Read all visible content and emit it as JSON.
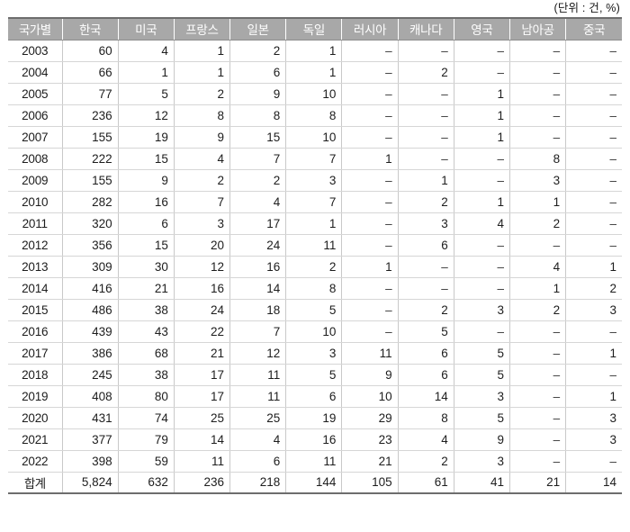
{
  "unit_note": "(단위 : 건, %)",
  "table": {
    "columns": [
      "국가별",
      "한국",
      "미국",
      "프랑스",
      "일본",
      "독일",
      "러시아",
      "캐나다",
      "영국",
      "남아공",
      "중국"
    ],
    "rows": [
      {
        "year": "2003",
        "values": [
          "60",
          "4",
          "1",
          "2",
          "1",
          "–",
          "–",
          "–",
          "–",
          "–"
        ]
      },
      {
        "year": "2004",
        "values": [
          "66",
          "1",
          "1",
          "6",
          "1",
          "–",
          "2",
          "–",
          "–",
          "–"
        ]
      },
      {
        "year": "2005",
        "values": [
          "77",
          "5",
          "2",
          "9",
          "10",
          "–",
          "–",
          "1",
          "–",
          "–"
        ]
      },
      {
        "year": "2006",
        "values": [
          "236",
          "12",
          "8",
          "8",
          "8",
          "–",
          "–",
          "1",
          "–",
          "–"
        ]
      },
      {
        "year": "2007",
        "values": [
          "155",
          "19",
          "9",
          "15",
          "10",
          "–",
          "–",
          "1",
          "–",
          "–"
        ]
      },
      {
        "year": "2008",
        "values": [
          "222",
          "15",
          "4",
          "7",
          "7",
          "1",
          "–",
          "–",
          "8",
          "–"
        ]
      },
      {
        "year": "2009",
        "values": [
          "155",
          "9",
          "2",
          "2",
          "3",
          "–",
          "1",
          "–",
          "3",
          "–"
        ]
      },
      {
        "year": "2010",
        "values": [
          "282",
          "16",
          "7",
          "4",
          "7",
          "–",
          "2",
          "1",
          "1",
          "–"
        ]
      },
      {
        "year": "2011",
        "values": [
          "320",
          "6",
          "3",
          "17",
          "1",
          "–",
          "3",
          "4",
          "2",
          "–"
        ]
      },
      {
        "year": "2012",
        "values": [
          "356",
          "15",
          "20",
          "24",
          "11",
          "–",
          "6",
          "–",
          "–",
          "–"
        ]
      },
      {
        "year": "2013",
        "values": [
          "309",
          "30",
          "12",
          "16",
          "2",
          "1",
          "–",
          "–",
          "4",
          "1"
        ]
      },
      {
        "year": "2014",
        "values": [
          "416",
          "21",
          "16",
          "14",
          "8",
          "–",
          "–",
          "–",
          "1",
          "2"
        ]
      },
      {
        "year": "2015",
        "values": [
          "486",
          "38",
          "24",
          "18",
          "5",
          "–",
          "2",
          "3",
          "2",
          "3"
        ]
      },
      {
        "year": "2016",
        "values": [
          "439",
          "43",
          "22",
          "7",
          "10",
          "–",
          "5",
          "–",
          "–",
          "–"
        ]
      },
      {
        "year": "2017",
        "values": [
          "386",
          "68",
          "21",
          "12",
          "3",
          "11",
          "6",
          "5",
          "–",
          "1"
        ]
      },
      {
        "year": "2018",
        "values": [
          "245",
          "38",
          "17",
          "11",
          "5",
          "9",
          "6",
          "5",
          "–",
          "–"
        ]
      },
      {
        "year": "2019",
        "values": [
          "408",
          "80",
          "17",
          "11",
          "6",
          "10",
          "14",
          "3",
          "–",
          "1"
        ]
      },
      {
        "year": "2020",
        "values": [
          "431",
          "74",
          "25",
          "25",
          "19",
          "29",
          "8",
          "5",
          "–",
          "3"
        ]
      },
      {
        "year": "2021",
        "values": [
          "377",
          "79",
          "14",
          "4",
          "16",
          "23",
          "4",
          "9",
          "–",
          "3"
        ]
      },
      {
        "year": "2022",
        "values": [
          "398",
          "59",
          "11",
          "6",
          "11",
          "21",
          "2",
          "3",
          "–",
          "–"
        ]
      }
    ],
    "total_row": {
      "year": "합계",
      "values": [
        "5,824",
        "632",
        "236",
        "218",
        "144",
        "105",
        "61",
        "41",
        "21",
        "14"
      ]
    }
  },
  "colors": {
    "header_bg": "#a8a8a8",
    "header_text": "#ffffff",
    "grid_line": "#c9c9c9",
    "outer_border": "#6d6d6d",
    "body_text": "#1d1d1d"
  }
}
